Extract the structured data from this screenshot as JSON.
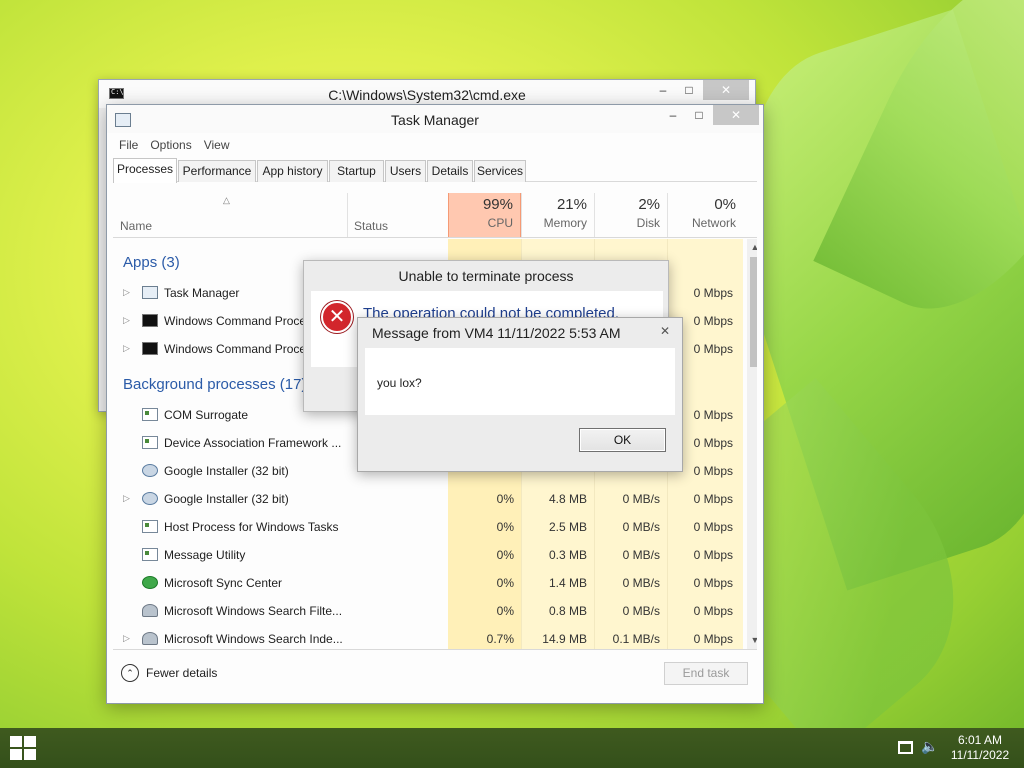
{
  "cmd_window": {
    "title": "C:\\Windows\\System32\\cmd.exe"
  },
  "task_manager": {
    "title": "Task Manager",
    "menu": [
      "File",
      "Options",
      "View"
    ],
    "tabs": [
      "Processes",
      "Performance",
      "App history",
      "Startup",
      "Users",
      "Details",
      "Services"
    ],
    "active_tab": "Processes",
    "columns": {
      "name": "Name",
      "status": "Status",
      "cpu": {
        "pct": "99%",
        "label": "CPU"
      },
      "memory": {
        "pct": "21%",
        "label": "Memory"
      },
      "disk": {
        "pct": "2%",
        "label": "Disk"
      },
      "network": {
        "pct": "0%",
        "label": "Network"
      }
    },
    "apps_header": "Apps (3)",
    "apps": [
      {
        "name": "Task Manager",
        "icon": "task-manager-icon",
        "expandable": true,
        "network": "0 Mbps"
      },
      {
        "name": "Windows Command Processor",
        "icon": "cmd-icon",
        "expandable": true,
        "network": "0 Mbps"
      },
      {
        "name": "Windows Command Processor",
        "icon": "cmd-icon",
        "expandable": true,
        "network": "0 Mbps"
      }
    ],
    "background_header": "Background processes (17)",
    "background": [
      {
        "name": "COM Surrogate",
        "icon": "service-icon",
        "expandable": false,
        "cpu": "",
        "memory": "",
        "disk": "",
        "network": "0 Mbps"
      },
      {
        "name": "Device Association Framework ...",
        "icon": "service-icon",
        "expandable": false,
        "cpu": "",
        "memory": "",
        "disk": "",
        "network": "0 Mbps"
      },
      {
        "name": "Google Installer (32 bit)",
        "icon": "installer-icon",
        "expandable": false,
        "cpu": "",
        "memory": "",
        "disk": "",
        "network": "0 Mbps"
      },
      {
        "name": "Google Installer (32 bit)",
        "icon": "installer-icon",
        "expandable": true,
        "cpu": "0%",
        "memory": "4.8 MB",
        "disk": "0 MB/s",
        "network": "0 Mbps"
      },
      {
        "name": "Host Process for Windows Tasks",
        "icon": "service-icon",
        "expandable": false,
        "cpu": "0%",
        "memory": "2.5 MB",
        "disk": "0 MB/s",
        "network": "0 Mbps"
      },
      {
        "name": "Message Utility",
        "icon": "service-icon",
        "expandable": false,
        "cpu": "0%",
        "memory": "0.3 MB",
        "disk": "0 MB/s",
        "network": "0 Mbps"
      },
      {
        "name": "Microsoft Sync Center",
        "icon": "sync-icon",
        "expandable": false,
        "cpu": "0%",
        "memory": "1.4 MB",
        "disk": "0 MB/s",
        "network": "0 Mbps"
      },
      {
        "name": "Microsoft Windows Search Filte...",
        "icon": "user-icon",
        "expandable": false,
        "cpu": "0%",
        "memory": "0.8 MB",
        "disk": "0 MB/s",
        "network": "0 Mbps"
      },
      {
        "name": "Microsoft Windows Search Inde...",
        "icon": "user-icon",
        "expandable": true,
        "cpu": "0.7%",
        "memory": "14.9 MB",
        "disk": "0.1 MB/s",
        "network": "0 Mbps"
      }
    ],
    "fewer_details": "Fewer details",
    "end_task": "End task"
  },
  "error_dialog": {
    "title": "Unable to terminate process",
    "message": "The operation could not be completed."
  },
  "message_dialog": {
    "title": "Message from VM4 11/11/2022 5:53 AM",
    "message": "you lox?",
    "ok": "OK"
  },
  "taskbar": {
    "time": "6:01 AM",
    "date": "11/11/2022"
  },
  "colors": {
    "cpu_header": "#ffc8b0",
    "column_heat": "#fff4c4",
    "section_blue": "#2b5ba8",
    "taskbar": "#3f5a1f"
  }
}
